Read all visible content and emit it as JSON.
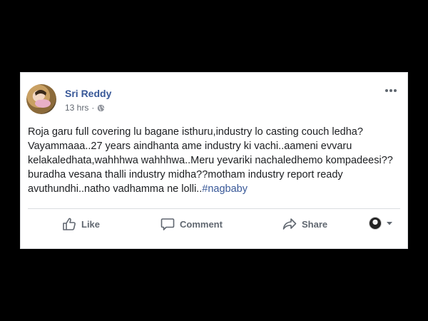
{
  "post": {
    "author": "Sri Reddy",
    "time": "13 hrs",
    "separator": "·",
    "privacy_icon": "globe-icon",
    "text_body": "Roja garu full covering lu bagane isthuru,industry lo casting couch ledha? Vayammaaa..27 years aindhanta ame industry ki vachi..aameni evvaru kelakaledhata,wahhhwa wahhhwa..Meru yevariki nachaledhemo kompadeesi?? buradha vesana thalli industry midha??motham industry report ready avuthundhi..natho vadhamma ne lolli..",
    "hashtag": "#nagbaby",
    "more_icon": "more-horizontal-icon"
  },
  "actions": {
    "like_label": "Like",
    "comment_label": "Comment",
    "share_label": "Share"
  },
  "colors": {
    "background": "#000000",
    "card": "#ffffff",
    "author_link": "#385898",
    "secondary_text": "#606770",
    "body_text": "#1c1e21"
  }
}
